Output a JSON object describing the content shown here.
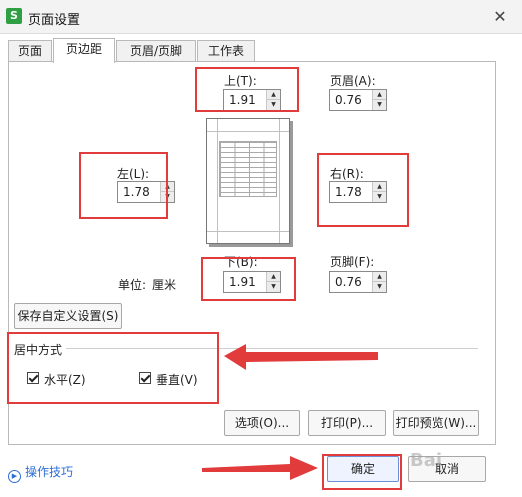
{
  "window": {
    "title": "页面设置",
    "app_icon_glyph": "S",
    "close_glyph": "✕"
  },
  "tabs": [
    "页面",
    "页边距",
    "页眉/页脚",
    "工作表"
  ],
  "active_tab_index": 1,
  "margins": {
    "top": {
      "label": "上(T):",
      "value": "1.91"
    },
    "header": {
      "label": "页眉(A):",
      "value": "0.76"
    },
    "left": {
      "label": "左(L):",
      "value": "1.78"
    },
    "right": {
      "label": "右(R):",
      "value": "1.78"
    },
    "bottom": {
      "label": "下(B):",
      "value": "1.91"
    },
    "footer": {
      "label": "页脚(F):",
      "value": "0.76"
    }
  },
  "unit": {
    "label": "单位:",
    "value": "厘米"
  },
  "save_custom_label": "保存自定义设置(S)",
  "center": {
    "title": "居中方式",
    "horizontal": {
      "label": "水平(Z)",
      "checked": true
    },
    "vertical": {
      "label": "垂直(V)",
      "checked": true
    }
  },
  "buttons": {
    "options": "选项(O)...",
    "print": "打印(P)...",
    "print_preview": "打印预览(W)..."
  },
  "footer": {
    "tips": "操作技巧",
    "ok": "确定",
    "cancel": "取消"
  },
  "colors": {
    "annotation_red": "#e23b3b",
    "link_blue": "#2d6fd6"
  },
  "icons": {
    "app": "wps-spreadsheet-icon",
    "close": "close-icon",
    "tips": "play-circle-icon",
    "spin_up": "triangle-up-icon",
    "spin_down": "triangle-down-icon"
  }
}
